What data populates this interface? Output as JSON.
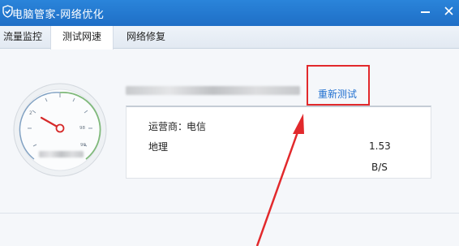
{
  "window": {
    "title": "电脑管家-网络优化",
    "accent_color": "#1f6fc6"
  },
  "tabs": [
    {
      "label": "流量监控",
      "active": false
    },
    {
      "label": "测试网速",
      "active": true
    },
    {
      "label": "网络修复",
      "active": false
    }
  ],
  "speed_test": {
    "retest_label": "重新测试",
    "highlight_color": "#e2292c",
    "gauge_labels": [
      "2",
      "98",
      "99"
    ],
    "results": {
      "isp_label": "运营商：",
      "isp_value": "电信",
      "address_label": "地理",
      "latency_value": "1.53",
      "speed_unit": "B/S"
    }
  },
  "icons": {
    "logo": "shield-check-icon",
    "minimize": "minimize-icon",
    "close": "close-icon",
    "gauge": "speedometer-gauge",
    "annotation": "red-arrow"
  }
}
